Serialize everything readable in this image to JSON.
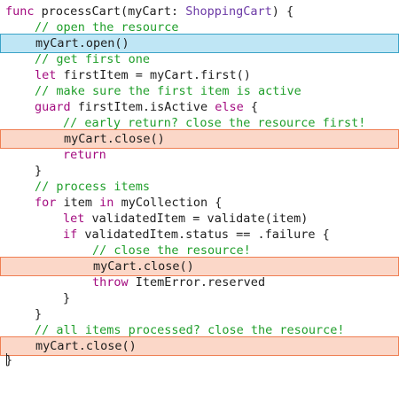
{
  "code": {
    "l1": {
      "kw": "func",
      "rest": " processCart(myCart: ",
      "type": "ShoppingCart",
      "end": ") {"
    },
    "l2": {
      "comment": "// open the resource"
    },
    "l3": {
      "text": "myCart.open()"
    },
    "l4": {
      "comment": "// get first one"
    },
    "l5": {
      "kw": "let",
      "rest": " firstItem = myCart.first()"
    },
    "l6": {
      "comment": "// make sure the first item is active"
    },
    "l7": {
      "kw": "guard",
      "mid": " firstItem.isActive ",
      "kw2": "else",
      "end": " {"
    },
    "l8": {
      "comment": "// early return? close the resource first!"
    },
    "l9": {
      "text": "myCart.close()"
    },
    "l10": {
      "kw": "return"
    },
    "l11": {
      "text": "}"
    },
    "l12": {
      "comment": "// process items"
    },
    "l13": {
      "kw": "for",
      "mid": " item ",
      "kw2": "in",
      "end": " myCollection {"
    },
    "l14": {
      "kw": "let",
      "rest": " validatedItem = validate(item)"
    },
    "l15": {
      "kw": "if",
      "rest": " validatedItem.status == .failure {"
    },
    "l16": {
      "comment": "// close the resource!"
    },
    "l17": {
      "text": "myCart.close()"
    },
    "l18": {
      "kw": "throw",
      "rest": " ItemError.reserved"
    },
    "l19": {
      "text": "}"
    },
    "l20": {
      "text": "}"
    },
    "l21": {
      "comment": "// all items processed? close the resource!"
    },
    "l22": {
      "text": "myCart.close()"
    },
    "l23": {
      "text": "}"
    }
  },
  "colors": {
    "keyword": "#a30b7f",
    "comment": "#1f9e2a",
    "type": "#6c3aa6",
    "highlight_open_bg": "#bfe6f5",
    "highlight_open_border": "#3ba3c7",
    "highlight_close_bg": "#fbd7c8",
    "highlight_close_border": "#ef7e52"
  }
}
